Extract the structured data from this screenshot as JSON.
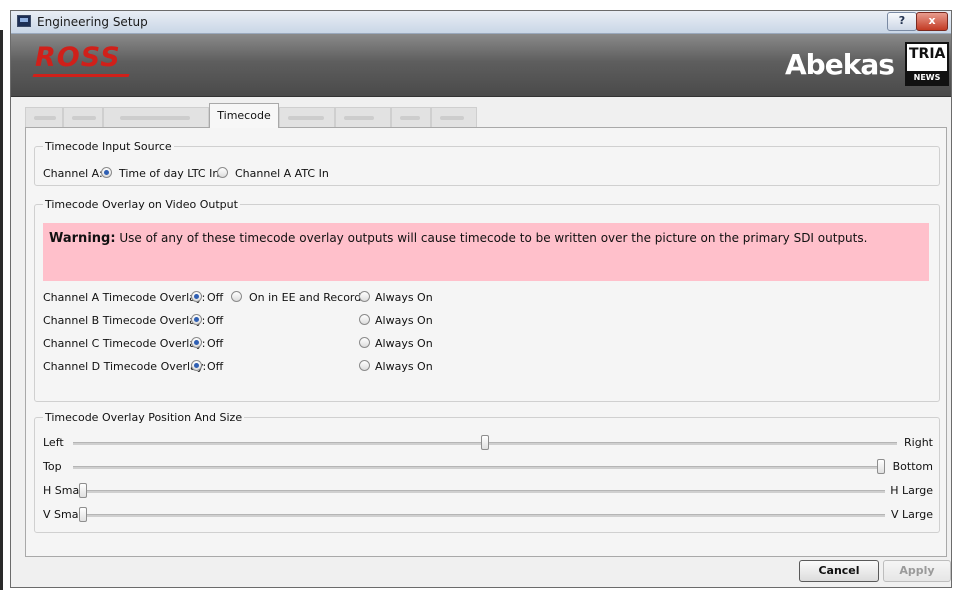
{
  "window": {
    "title": "Engineering Setup",
    "help_label": "?",
    "close_label": "x"
  },
  "branding": {
    "left_logo": "ROSS",
    "right_logo": "Abekas",
    "badge_top": "TRIA",
    "badge_bottom": "NEWS",
    "colors": {
      "ross_red": "#d0201a",
      "banner": "#5e5e5e"
    }
  },
  "tabs": {
    "active_label": "Timecode"
  },
  "input_source": {
    "legend": "Timecode Input Source",
    "label": "Channel A:",
    "options": [
      {
        "label": "Time of day LTC In",
        "selected": true
      },
      {
        "label": "Channel A ATC In",
        "selected": false
      }
    ]
  },
  "overlay": {
    "legend": "Timecode Overlay on Video Output",
    "warning_label": "Warning:",
    "warning_text": "Use of any of these timecode overlay outputs will cause timecode to be written over the picture on the primary SDI outputs.",
    "warning_color": "#ffc0cb",
    "rows": [
      {
        "label": "Channel A Timecode Overlay:",
        "off": "Off",
        "middle": "On in EE and Record",
        "always": "Always On",
        "selected": "Off"
      },
      {
        "label": "Channel B Timecode Overlay:",
        "off": "Off",
        "always": "Always On",
        "selected": "Off"
      },
      {
        "label": "Channel C Timecode Overlay:",
        "off": "Off",
        "always": "Always On",
        "selected": "Off"
      },
      {
        "label": "Channel D Timecode Overlay:",
        "off": "Off",
        "always": "Always On",
        "selected": "Off"
      }
    ]
  },
  "position": {
    "legend": "Timecode Overlay Position And Size",
    "sliders": [
      {
        "left": "Left",
        "right": "Right",
        "value": 0.5
      },
      {
        "left": "Top",
        "right": "Bottom",
        "value": 1.0
      },
      {
        "left": "H Small",
        "right": "H Large",
        "value": 0.0
      },
      {
        "left": "V Small",
        "right": "V Large",
        "value": 0.0
      }
    ]
  },
  "buttons": {
    "cancel": "Cancel",
    "apply": "Apply"
  }
}
